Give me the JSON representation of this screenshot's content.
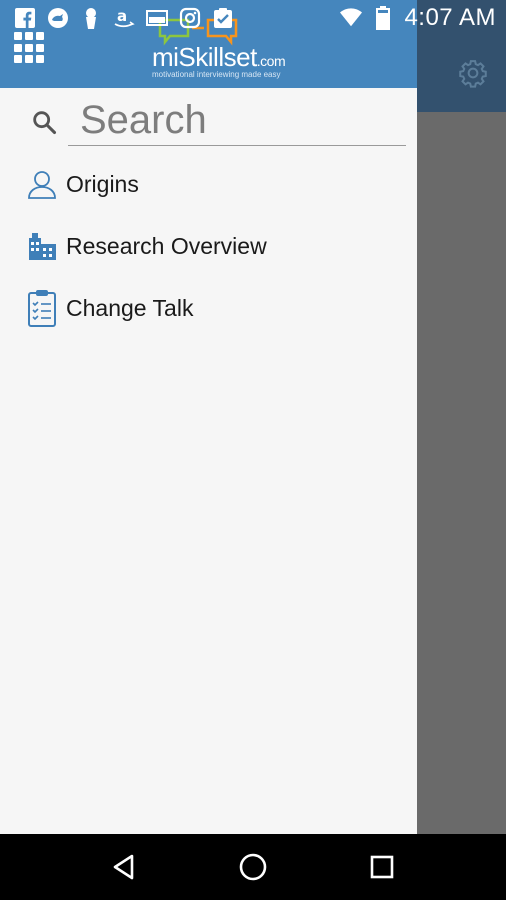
{
  "status_bar": {
    "time": "4:07 AM",
    "left_icons": [
      "facebook-icon",
      "rhino-app-icon",
      "keyhole-icon",
      "amazon-icon",
      "image-icon",
      "instagram-icon",
      "clipboard-check-icon"
    ],
    "right_icons": [
      "wifi-icon",
      "battery-icon"
    ]
  },
  "drawer": {
    "logo": {
      "wordmark": "miSkillset",
      "domain": ".com",
      "tagline": "motivational interviewing made easy"
    },
    "search": {
      "placeholder": "Search",
      "value": ""
    },
    "menu": [
      {
        "label": "Origins",
        "icon": "person-icon"
      },
      {
        "label": "Research Overview",
        "icon": "buildings-icon"
      },
      {
        "label": "Change Talk",
        "icon": "clipboard-list-icon"
      }
    ]
  },
  "background_header": {
    "icon": "gear-icon"
  },
  "nav_bar": {
    "buttons": [
      "back-triangle-icon",
      "home-circle-icon",
      "recents-square-icon"
    ]
  },
  "colors": {
    "drawer_header": "#4586bd",
    "app_header_dim": "#33516e",
    "drawer_bg": "#f6f6f6",
    "scrim": "#6a6a6a",
    "icon_blue": "#3f7fb8",
    "logo_green": "#8dc63f",
    "logo_orange": "#f7941d"
  }
}
